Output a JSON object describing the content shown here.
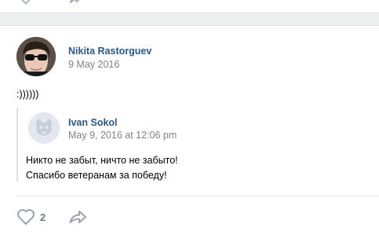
{
  "post": {
    "author": {
      "name": "Nikita Rastorguev",
      "date": "9 May 2016"
    },
    "text": ":))))))",
    "repost": {
      "author": {
        "name": "Ivan Sokol",
        "date": "May 9, 2016 at 12:06 pm"
      },
      "lines": [
        "Никто не забыт, ничто не забыто!",
        "Спасибо ветеранам за победу!"
      ]
    },
    "actions": {
      "like_count": "2",
      "like_icon": "heart-icon",
      "share_icon": "share-arrow-icon"
    }
  },
  "colors": {
    "link": "#2a5885",
    "meta": "#828282",
    "icon": "#99a2ad",
    "background": "#edeef0"
  }
}
